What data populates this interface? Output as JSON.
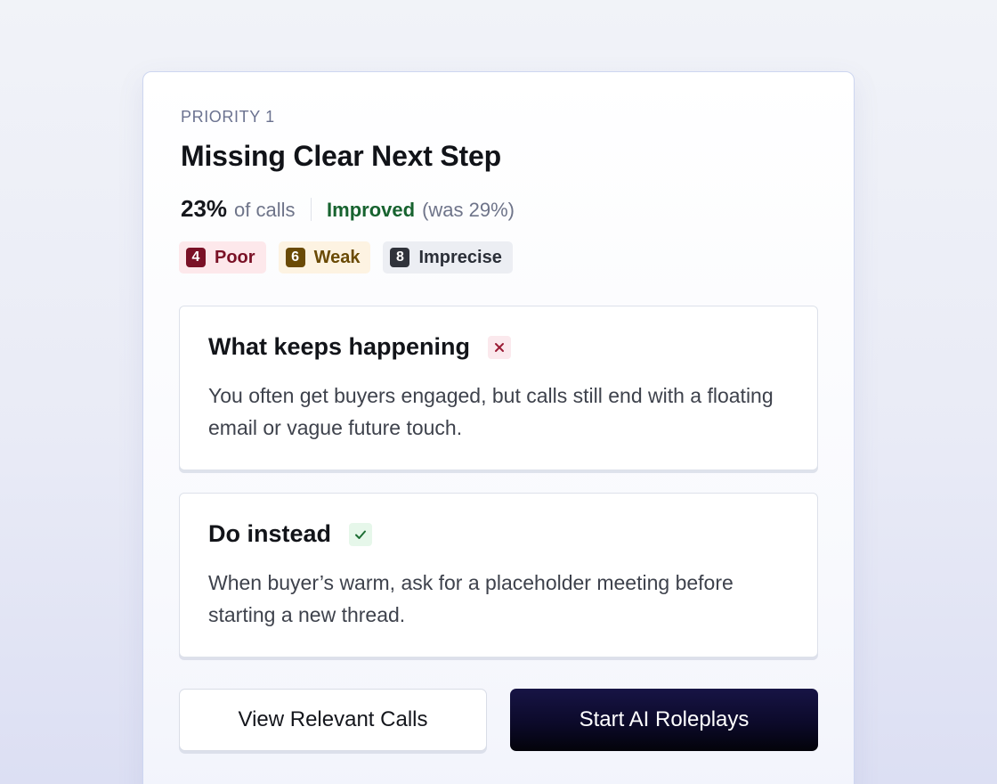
{
  "priority_label": "PRIORITY 1",
  "title": "Missing Clear Next Step",
  "stats": {
    "percent": "23%",
    "percent_label": "of calls",
    "status": "Improved",
    "previous": "(was 29%)"
  },
  "chips": [
    {
      "count": "4",
      "label": "Poor",
      "color": "#7a1126"
    },
    {
      "count": "6",
      "label": "Weak",
      "color": "#6a4a05"
    },
    {
      "count": "8",
      "label": "Imprecise",
      "color": "#30333b"
    }
  ],
  "what_keeps_happening": {
    "title": "What keeps happening",
    "icon": "close-icon",
    "text": "You often get buyers engaged, but calls still end with a floating email or vague future touch."
  },
  "do_instead": {
    "title": "Do instead",
    "icon": "check-icon",
    "text": "When buyer’s warm, ask for a placeholder meeting before starting a new thread."
  },
  "actions": {
    "secondary_label": "View Relevant Calls",
    "primary_label": "Start AI Roleplays"
  },
  "colors": {
    "improved": "#17632f",
    "primary_button": "#0c0a2a",
    "card_border": "#cdd6f0"
  }
}
